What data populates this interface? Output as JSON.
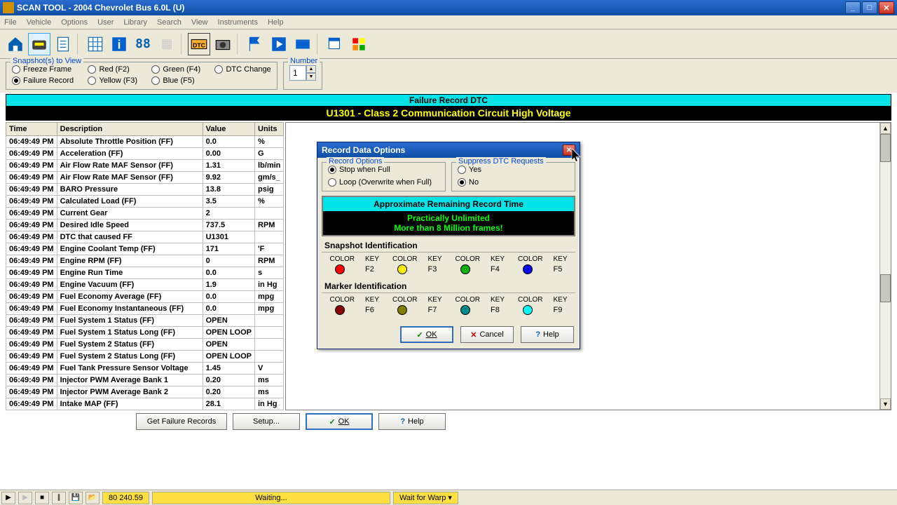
{
  "titlebar": {
    "title": "SCAN TOOL  -  2004 Chevrolet Bus  6.0L (U)"
  },
  "menu": [
    "File",
    "Vehicle",
    "Options",
    "User",
    "Library",
    "Search",
    "View",
    "Instruments",
    "Help"
  ],
  "snapshots": {
    "legend": "Snapshot(s) to View",
    "items": [
      {
        "label": "Freeze Frame",
        "sel": false
      },
      {
        "label": "Red (F2)",
        "sel": false
      },
      {
        "label": "Green (F4)",
        "sel": false
      },
      {
        "label": "DTC Change",
        "sel": false
      },
      {
        "label": "Failure Record",
        "sel": true
      },
      {
        "label": "Yellow (F3)",
        "sel": false
      },
      {
        "label": "Blue (F5)",
        "sel": false
      }
    ]
  },
  "number": {
    "legend": "Number",
    "value": "1"
  },
  "dtc": {
    "title": "Failure Record DTC",
    "code": "U1301  - Class 2 Communication Circuit High Voltage"
  },
  "table": {
    "headers": [
      "Time",
      "Description",
      "Value",
      "Units"
    ],
    "rows": [
      [
        "06:49:49 PM",
        "Absolute Throttle Position (FF)",
        "0.0",
        "%"
      ],
      [
        "06:49:49 PM",
        "Acceleration (FF)",
        "0.00",
        "G"
      ],
      [
        "06:49:49 PM",
        "Air Flow Rate MAF Sensor (FF)",
        "1.31",
        "lb/min"
      ],
      [
        "06:49:49 PM",
        "Air Flow Rate MAF Sensor (FF)",
        "9.92",
        "gm/s_"
      ],
      [
        "06:49:49 PM",
        "BARO Pressure",
        "13.8",
        "psig"
      ],
      [
        "06:49:49 PM",
        "Calculated Load (FF)",
        "3.5",
        "%"
      ],
      [
        "06:49:49 PM",
        "Current Gear",
        "2",
        ""
      ],
      [
        "06:49:49 PM",
        "Desired Idle Speed",
        "737.5",
        "RPM"
      ],
      [
        "06:49:49 PM",
        "DTC that caused  FF",
        "U1301",
        ""
      ],
      [
        "06:49:49 PM",
        "Engine Coolant Temp (FF)",
        "171",
        "'F"
      ],
      [
        "06:49:49 PM",
        "Engine RPM (FF)",
        "0",
        "RPM"
      ],
      [
        "06:49:49 PM",
        "Engine Run Time",
        "0.0",
        "s"
      ],
      [
        "06:49:49 PM",
        "Engine Vacuum (FF)",
        "1.9",
        "in Hg"
      ],
      [
        "06:49:49 PM",
        "Fuel Economy Average (FF)",
        "0.0",
        "mpg"
      ],
      [
        "06:49:49 PM",
        "Fuel Economy Instantaneous (FF)",
        "0.0",
        "mpg"
      ],
      [
        "06:49:49 PM",
        "Fuel System 1 Status (FF)",
        "OPEN",
        ""
      ],
      [
        "06:49:49 PM",
        "Fuel System 1 Status Long (FF)",
        "OPEN LOOP",
        ""
      ],
      [
        "06:49:49 PM",
        "Fuel System 2 Status (FF)",
        "OPEN",
        ""
      ],
      [
        "06:49:49 PM",
        "Fuel System 2 Status Long (FF)",
        "OPEN LOOP",
        ""
      ],
      [
        "06:49:49 PM",
        "Fuel Tank Pressure Sensor Voltage",
        "1.45",
        "V"
      ],
      [
        "06:49:49 PM",
        "Injector PWM Average Bank 1",
        "0.20",
        "ms"
      ],
      [
        "06:49:49 PM",
        "Injector PWM Average Bank 2",
        "0.20",
        "ms"
      ],
      [
        "06:49:49 PM",
        "Intake MAP (FF)",
        "28.1",
        "in Hg"
      ]
    ]
  },
  "buttons": {
    "get_failure": "Get Failure Records",
    "setup": "Setup...",
    "ok": "OK",
    "help": "Help"
  },
  "statusbar": {
    "yellow": "80  240.59",
    "waiting": "Waiting...",
    "warp": "Wait for Warp"
  },
  "modal": {
    "title": "Record Data Options",
    "record_options": {
      "legend": "Record Options",
      "opt1": "Stop when Full",
      "opt2": "Loop (Overwrite when Full)",
      "selected": 0
    },
    "suppress": {
      "legend": "Suppress DTC Requests",
      "yes": "Yes",
      "no": "No",
      "selected": 1
    },
    "rec_time": {
      "title": "Approximate Remaining Record Time",
      "line1": "Practically Unlimited",
      "line2": "More than 8 Million frames!"
    },
    "snapshot_id": {
      "title": "Snapshot Identification",
      "hdr_color": "COLOR",
      "hdr_key": "KEY",
      "items": [
        {
          "color": "#ff0000",
          "key": "F2"
        },
        {
          "color": "#ffee00",
          "key": "F3"
        },
        {
          "color": "#00b000",
          "key": "F4"
        },
        {
          "color": "#0000ff",
          "key": "F5"
        }
      ]
    },
    "marker_id": {
      "title": "Marker Identification",
      "items": [
        {
          "color": "#8b0000",
          "key": "F6"
        },
        {
          "color": "#808000",
          "key": "F7"
        },
        {
          "color": "#008b8b",
          "key": "F8"
        },
        {
          "color": "#00ffff",
          "key": "F9"
        }
      ]
    },
    "buttons": {
      "ok": "OK",
      "cancel": "Cancel",
      "help": "Help"
    }
  }
}
